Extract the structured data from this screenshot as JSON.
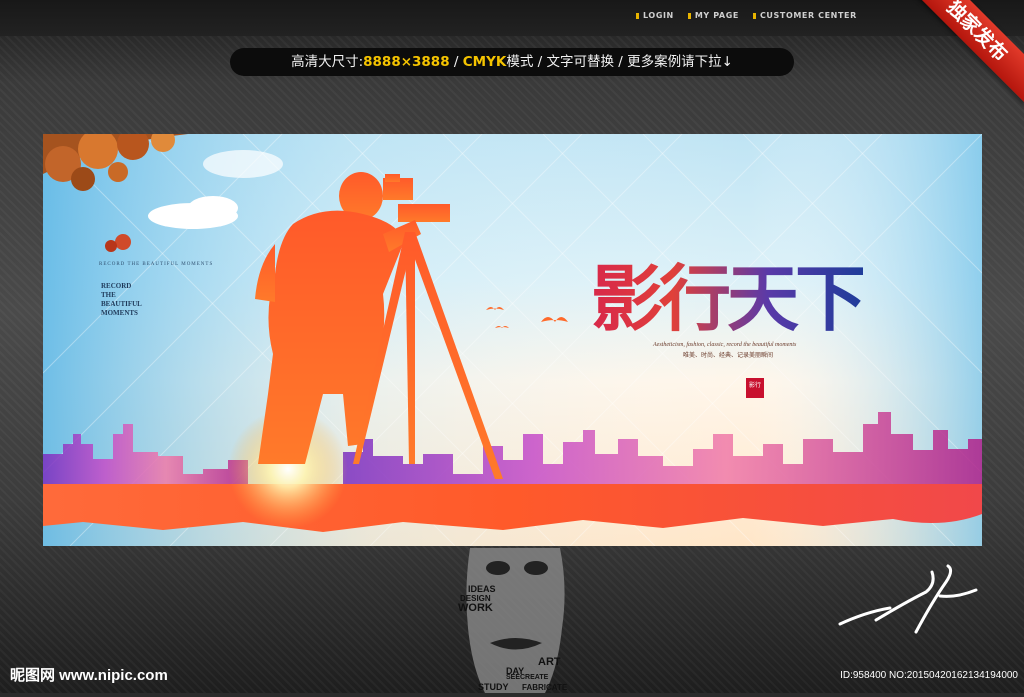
{
  "topnav": [
    "LOGIN",
    "MY PAGE",
    "CUSTOMER CENTER"
  ],
  "ribbon": "独家发布",
  "info_bar": {
    "part1": "高清大尺寸:",
    "size": "8888×3888",
    "sep1": " / ",
    "cmyk": "CMYK",
    "part2": "模式 / 文字可替换 / 更多案例请下拉↓"
  },
  "banner": {
    "title": "影行天下",
    "english_small": "RECORD THE BEAUTIFUL MOMENTS",
    "record_lines": [
      "RECORD",
      "THE",
      "BEAUTIFUL",
      "MOMENTS"
    ],
    "tagline_en": "Aestheticism, fashion, classic, record the beautiful moments",
    "tagline_cn": "唯美、时尚、经典、记录美丽瞬间",
    "seal": "影行"
  },
  "face_words": [
    "IDEAS",
    "DESIGN",
    "WORK",
    "ART",
    "DAY",
    "STUDY",
    "SEECREATE",
    "FABRICATE"
  ],
  "footer": {
    "site": "昵图网 www.nipic.com",
    "id_text": "ID:958400 NO:20150420162134194000"
  },
  "colors": {
    "accent_yellow": "#f5c400",
    "ribbon_red": "#d12a1c",
    "silhouette_orange": "#ff5a1f",
    "title_red": "#d6283c",
    "title_blue": "#1e3c9a"
  }
}
